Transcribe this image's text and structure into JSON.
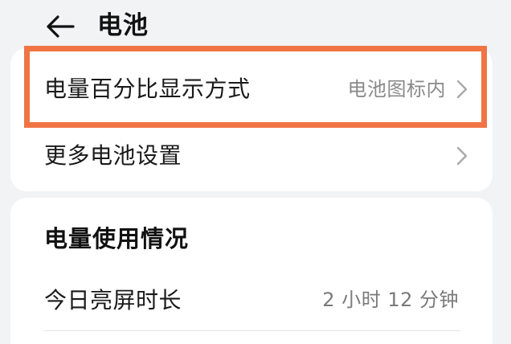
{
  "header": {
    "title": "电池",
    "back_icon": "arrow-left-icon"
  },
  "settings_card": {
    "percent_display": {
      "label": "电量百分比显示方式",
      "value": "电池图标内",
      "icon": "chevron-right-icon"
    },
    "more_settings": {
      "label": "更多电池设置",
      "icon": "chevron-right-icon"
    }
  },
  "usage_card": {
    "title": "电量使用情况",
    "screen_on": {
      "label": "今日亮屏时长",
      "value": "2 小时 12 分钟"
    }
  },
  "colors": {
    "highlight": "#f07444",
    "background": "#f1f3f5",
    "card": "#ffffff",
    "secondary_text": "#8a8a8a"
  }
}
